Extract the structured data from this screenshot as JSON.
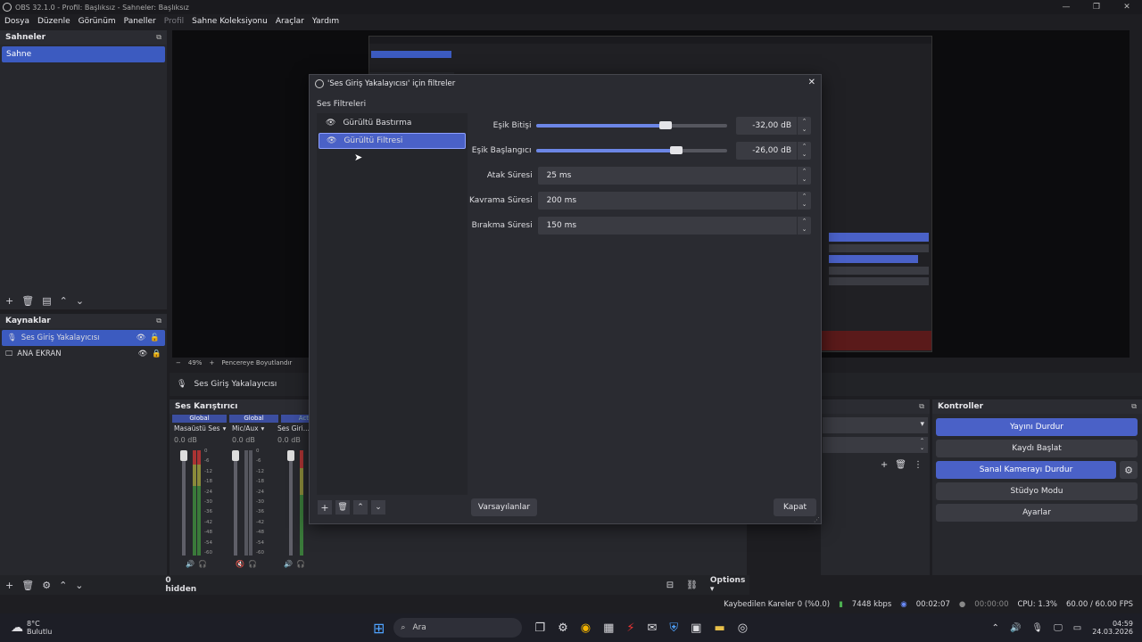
{
  "window": {
    "title": "OBS 32.1.0 - Profil: Başlıksız - Sahneler: Başlıksız"
  },
  "menu": {
    "items": [
      "Dosya",
      "Düzenle",
      "Görünüm",
      "Paneller",
      "Profil",
      "Sahne Koleksiyonu",
      "Araçlar",
      "Yardım"
    ]
  },
  "scenes": {
    "title": "Sahneler",
    "items": [
      "Sahne"
    ]
  },
  "sources": {
    "title": "Kaynaklar",
    "items": [
      "Ses Giriş Yakalayıcısı",
      "ANA EKRAN"
    ]
  },
  "preview_bar": {
    "zoom": "49%",
    "fit": "Pencereye Boyutlandır"
  },
  "source_toolbar": {
    "label": "Ses Giriş Yakalayıcısı"
  },
  "mixer": {
    "title": "Ses Karıştırıcı",
    "channels": [
      {
        "tag": "Global",
        "name": "Masaüstü Ses",
        "db": "0.0 dB"
      },
      {
        "tag": "Global",
        "name": "Mic/Aux",
        "db": "0.0 dB"
      },
      {
        "tag": "Acti",
        "name": "Ses Giri...la",
        "db": "0.0 dB"
      }
    ],
    "scale": [
      "0",
      "-6",
      "-12",
      "-18",
      "-24",
      "-30",
      "-36",
      "-42",
      "-48",
      "-54",
      "-60"
    ],
    "hidden": "0 hidden",
    "options": "Options"
  },
  "controls": {
    "title": "Kontroller",
    "stream": "Yayını Durdur",
    "record": "Kaydı Başlat",
    "virtualcam": "Sanal Kamerayı Durdur",
    "studio": "Stüdyo Modu",
    "settings": "Ayarlar"
  },
  "status": {
    "dropped": "Kaybedilen Kareler 0 (%0.0)",
    "bitrate": "7448 kbps",
    "stream_time": "00:02:07",
    "rec_time": "00:00:00",
    "cpu": "CPU: 1.3%",
    "fps": "60.00 / 60.00 FPS"
  },
  "dialog": {
    "title": "'Ses Giriş Yakalayıcısı' için filtreler",
    "section": "Ses Filtreleri",
    "filters": [
      "Gürültü Bastırma",
      "Gürültü Filtresi"
    ],
    "props": [
      {
        "label": "Eşik Bitişi",
        "value": "-32,00 dB",
        "fill": 0.66
      },
      {
        "label": "Eşik Başlangıcı",
        "value": "-26,00 dB",
        "fill": 0.72
      },
      {
        "label": "Atak Süresi",
        "value": "25 ms"
      },
      {
        "label": "Kavrama Süresi",
        "value": "200 ms"
      },
      {
        "label": "Bırakma Süresi",
        "value": "150 ms"
      }
    ],
    "defaults": "Varsayılanlar",
    "close": "Kapat"
  },
  "taskbar": {
    "temp": "8°C",
    "weather": "Bulutlu",
    "search": "Ara",
    "time": "04:59",
    "date": "24.03.2026"
  },
  "colors": {
    "accent": "#4a61c7",
    "bg": "#1e1e22"
  }
}
